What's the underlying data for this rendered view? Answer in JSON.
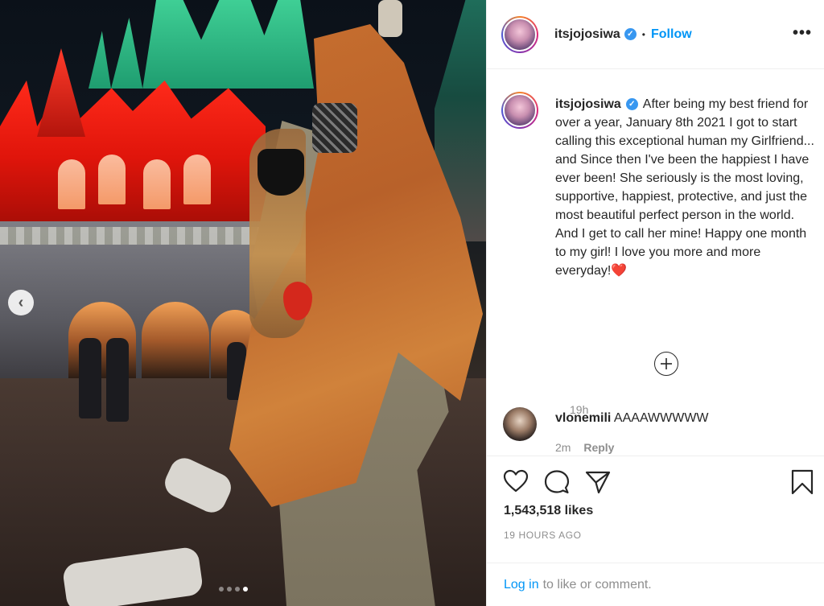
{
  "post": {
    "username": "itsjojosiwa",
    "follow_label": "Follow",
    "more_icon": "more-options-icon",
    "caption": "After being my best friend for over a year, January 8th 2021 I got to start calling this exceptional human my Girlfriend... and Since then I've been the happiest I have ever been! She seriously is the most loving, supportive, happiest, protective, and just the most beautiful perfect person in the world. And I get to call her mine! Happy one month to my girl! I love you more and more everyday!❤️",
    "caption_time": "19h",
    "likes": "1,543,518 likes",
    "post_time": "19 HOURS AGO"
  },
  "comments": [
    {
      "username": "vlonemili",
      "text": "AAAAWWWWW",
      "time": "2m",
      "reply_label": "Reply"
    }
  ],
  "login": {
    "link_label": "Log in",
    "rest_text": "to like or comment."
  },
  "carousel": {
    "slide_count": 4,
    "active_index": 3
  },
  "colors": {
    "link": "#0095f6",
    "verified": "#3897f0",
    "muted": "#8e8e8e",
    "text": "#262626",
    "border": "#efefef"
  }
}
